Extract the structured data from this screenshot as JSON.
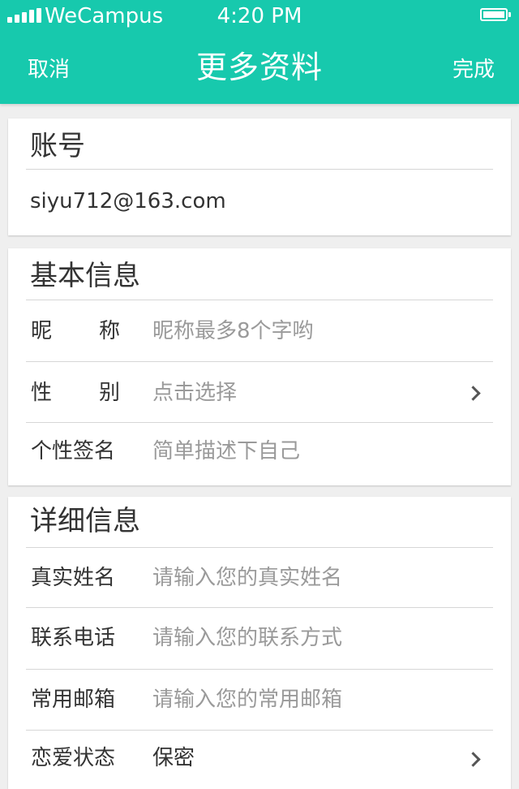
{
  "status_bar": {
    "carrier": "WeCampus",
    "time": "4:20 PM"
  },
  "nav": {
    "cancel": "取消",
    "title": "更多资料",
    "done": "完成"
  },
  "account": {
    "title": "账号",
    "value": "siyu712@163.com"
  },
  "basic": {
    "title": "基本信息",
    "rows": [
      {
        "label": "昵称",
        "placeholder": "昵称最多8个字哟"
      },
      {
        "label": "性别",
        "placeholder": "点击选择"
      },
      {
        "label": "个性签名",
        "placeholder": "简单描述下自己"
      }
    ]
  },
  "detail": {
    "title": "详细信息",
    "rows": [
      {
        "label": "真实姓名",
        "placeholder": "请输入您的真实姓名"
      },
      {
        "label": "联系电话",
        "placeholder": "请输入您的联系方式"
      },
      {
        "label": "常用邮箱",
        "placeholder": "请输入您的常用邮箱"
      },
      {
        "label": "恋爱状态",
        "value": "保密"
      }
    ]
  },
  "colors": {
    "accent": "#17c9ad",
    "background": "#efefef",
    "placeholder": "#9a9a9a"
  },
  "icons": {
    "signal": "signal-icon",
    "battery": "battery-icon",
    "disclosure": "chevron-right-icon"
  }
}
